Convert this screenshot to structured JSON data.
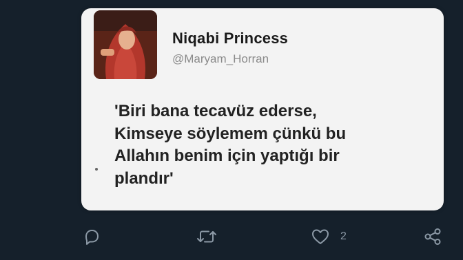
{
  "tweet": {
    "author_name": "Niqabi Princess",
    "author_handle": "@Maryam_Horran",
    "text_lines": [
      "'Biri bana tecavüz ederse,",
      "Kimseye söylemem çünkü bu",
      "Allahın benim için yaptığı bir",
      "plandır'"
    ]
  },
  "actions": {
    "reply_icon": "reply-icon",
    "retweet_icon": "retweet-icon",
    "like_icon": "heart-icon",
    "like_count": "2",
    "share_icon": "share-icon"
  },
  "colors": {
    "background": "#15202b",
    "card": "#f3f3f3",
    "action_icons": "#8b98a5"
  }
}
